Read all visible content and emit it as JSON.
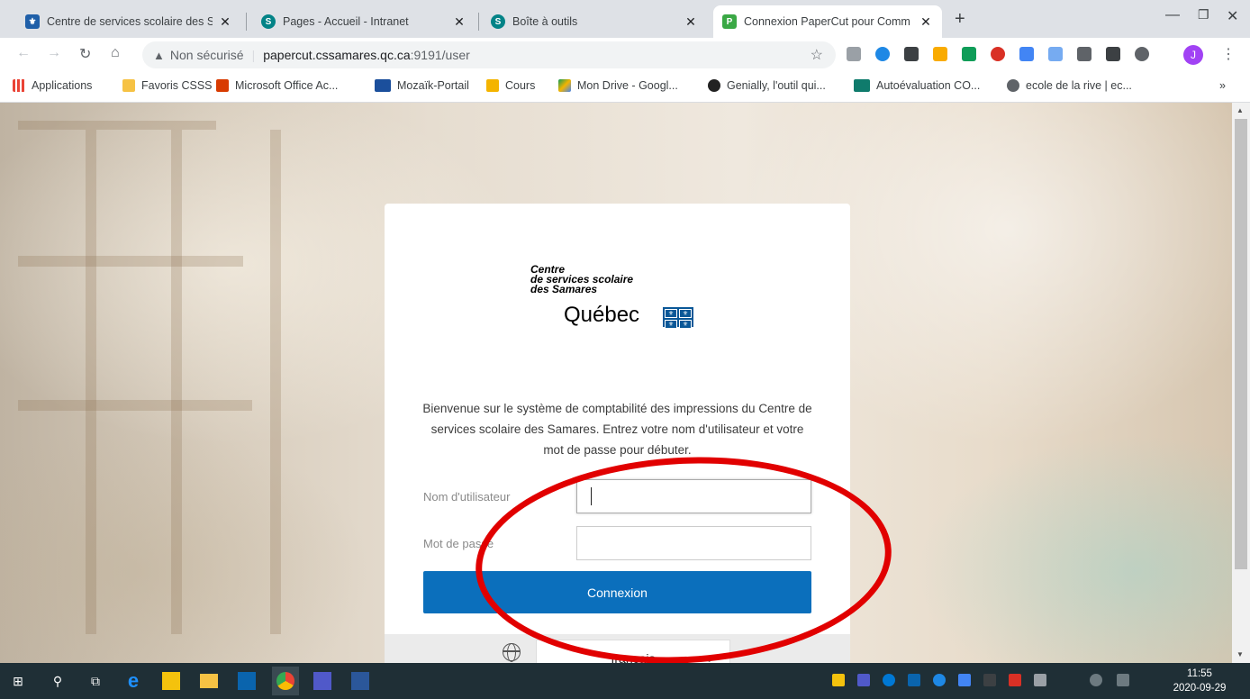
{
  "browser": {
    "tabs": [
      {
        "title": "Centre de services scolaire des Sa",
        "icon": "fleur-de-lis-icon",
        "color": "#1f5fa8"
      },
      {
        "title": "Pages - Accueil - Intranet",
        "icon": "sharepoint-icon",
        "color": "#038387"
      },
      {
        "title": "Boîte à outils",
        "icon": "sharepoint-icon",
        "color": "#038387"
      },
      {
        "title": "Connexion PaperCut pour Comm",
        "icon": "papercut-icon",
        "color": "#3aa845",
        "active": true
      }
    ],
    "address": {
      "security_label": "Non sécurisé",
      "host": "papercut.cssamares.qc.ca",
      "path": ":9191/user"
    },
    "avatar_initial": "J",
    "bookmarks": [
      {
        "label": "Applications",
        "icon": "apps-grid-icon"
      },
      {
        "label": "Favoris CSSS",
        "icon": "folder-icon"
      },
      {
        "label": "Microsoft Office Ac...",
        "icon": "office-icon"
      },
      {
        "label": "Mozaïk-Portail",
        "icon": "mozaik-icon"
      },
      {
        "label": "Cours",
        "icon": "classroom-icon"
      },
      {
        "label": "Mon Drive - Googl...",
        "icon": "google-drive-icon"
      },
      {
        "label": "Genially, l'outil qui...",
        "icon": "genially-icon"
      },
      {
        "label": "Autoévaluation CO...",
        "icon": "forms-icon"
      },
      {
        "label": "ecole de la rive | ec...",
        "icon": "globe-icon"
      }
    ],
    "more_bookmarks": "»"
  },
  "login": {
    "org_line1": "Centre",
    "org_line2": "de services scolaire",
    "org_line3": "des Samares",
    "gov_name": "Québec",
    "welcome": "Bienvenue sur le système de comptabilité des impressions du Centre de services scolaire des Samares. Entrez votre nom d'utilisateur et votre mot de passe pour débuter.",
    "username_label": "Nom d'utilisateur",
    "password_label": "Mot de passe",
    "username_value": "",
    "password_value": "",
    "submit_label": "Connexion",
    "language": "français"
  },
  "taskbar": {
    "time": "11:55",
    "date": "2020-09-29"
  },
  "colors": {
    "primary_button": "#0b6fbc",
    "annotation": "#e10000"
  }
}
